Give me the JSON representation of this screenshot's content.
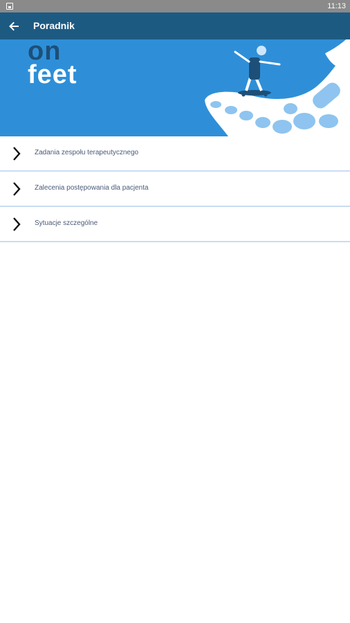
{
  "status_bar": {
    "time": "11:13",
    "notification_icon": "image-notification-icon"
  },
  "app_bar": {
    "title": "Poradnik",
    "back_icon": "arrow-back-icon",
    "background": "#1d5a82"
  },
  "banner": {
    "word_top": "on",
    "word_bottom": "feet",
    "background": "#2e8fd8",
    "illustration": "skateboarder-on-foot-bones"
  },
  "menu": {
    "items": [
      {
        "label": "Zadania zespołu terapeutycznego",
        "icon": "chevron-right-icon"
      },
      {
        "label": "Zalecenia postępowania dla pacjenta",
        "icon": "chevron-right-icon"
      },
      {
        "label": "Sytuacje szczególne",
        "icon": "chevron-right-icon"
      }
    ]
  }
}
